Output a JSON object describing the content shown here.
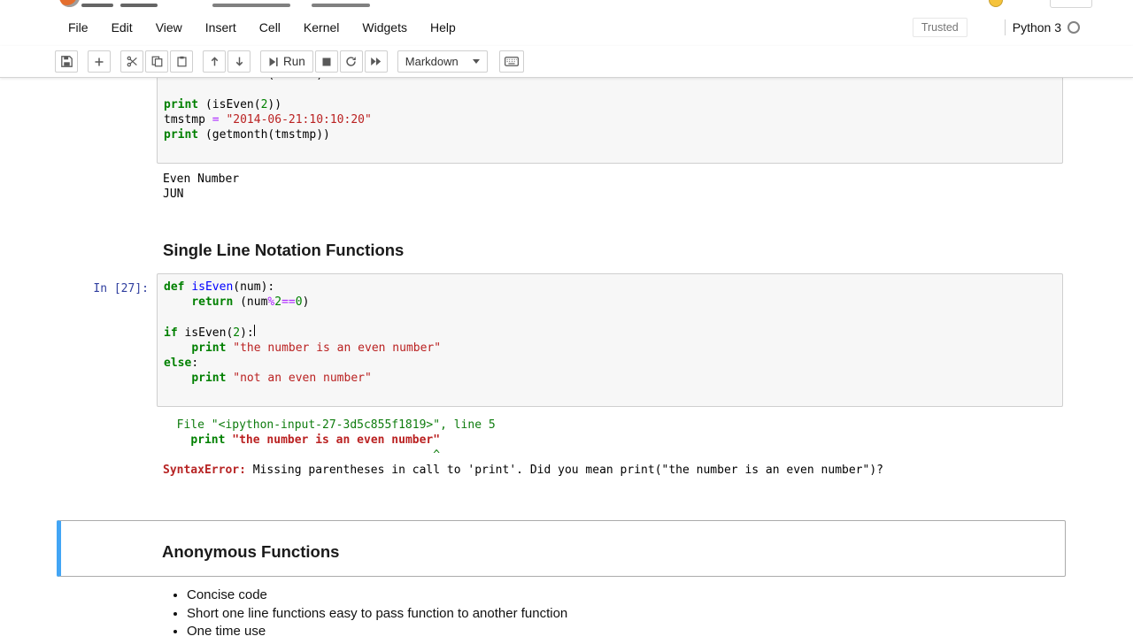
{
  "colors": {
    "selected_cell_accent": "#42A5F5",
    "prompt_blue": "#303F9F",
    "keyword_green": "#008000",
    "string_red": "#BA2121",
    "operator_purple": "#AA22FF",
    "error_red": "#b72424",
    "jupyter_orange": "#e46e2e"
  },
  "header": {
    "icons": [
      "jupyter-logo",
      "user-avatar",
      "logout-button"
    ]
  },
  "menubar": {
    "items": [
      {
        "label": "File"
      },
      {
        "label": "Edit"
      },
      {
        "label": "View"
      },
      {
        "label": "Insert"
      },
      {
        "label": "Cell"
      },
      {
        "label": "Kernel"
      },
      {
        "label": "Widgets"
      },
      {
        "label": "Help"
      }
    ],
    "trusted": "Trusted",
    "kernel": "Python 3"
  },
  "toolbar": {
    "run_label": "Run",
    "cell_type": "Markdown",
    "icons": [
      "save-icon",
      "add-cell-icon",
      "cut-icon",
      "copy-icon",
      "paste-icon",
      "move-up-icon",
      "move-down-icon",
      "run-icon",
      "stop-icon",
      "restart-icon",
      "restart-run-all-icon",
      "command-palette-icon"
    ]
  },
  "cells": {
    "code1": {
      "lines": [
        [],
        [],
        [],
        [
          {
            "t": "        ",
            "c": "pl"
          },
          {
            "t": "return",
            "c": "kw"
          },
          {
            "t": " (months)",
            "c": "pl"
          }
        ],
        [],
        [
          {
            "t": "print",
            "c": "kw"
          },
          {
            "t": " (isEven(",
            "c": "pl"
          },
          {
            "t": "2",
            "c": "nm"
          },
          {
            "t": "))",
            "c": "pl"
          }
        ],
        [
          {
            "t": "tmstmp ",
            "c": "pl"
          },
          {
            "t": "=",
            "c": "op"
          },
          {
            "t": " ",
            "c": "pl"
          },
          {
            "t": "\"2014-06-21:10:10:20\"",
            "c": "st"
          }
        ],
        [
          {
            "t": "print",
            "c": "kw"
          },
          {
            "t": " (getmonth(tmstmp))",
            "c": "pl"
          }
        ],
        []
      ]
    },
    "output1": [
      "Even Number",
      "JUN"
    ],
    "heading1": "Single Line Notation Functions",
    "code2": {
      "prompt": "In [27]:",
      "lines": [
        [
          {
            "t": "def",
            "c": "kw"
          },
          {
            "t": " ",
            "c": "pl"
          },
          {
            "t": "isEven",
            "c": "df"
          },
          {
            "t": "(num):",
            "c": "pl"
          }
        ],
        [
          {
            "t": "    ",
            "c": "pl"
          },
          {
            "t": "return",
            "c": "kw"
          },
          {
            "t": " (num",
            "c": "pl"
          },
          {
            "t": "%",
            "c": "op"
          },
          {
            "t": "2",
            "c": "nm"
          },
          {
            "t": "==",
            "c": "op"
          },
          {
            "t": "0",
            "c": "nm"
          },
          {
            "t": ")",
            "c": "pl"
          }
        ],
        [],
        [
          {
            "t": "if",
            "c": "kw"
          },
          {
            "t": " isEven(",
            "c": "pl"
          },
          {
            "t": "2",
            "c": "nm"
          },
          {
            "t": "):",
            "c": "pl"
          },
          {
            "t": "",
            "c": "cur"
          }
        ],
        [
          {
            "t": "    ",
            "c": "pl"
          },
          {
            "t": "print",
            "c": "kw"
          },
          {
            "t": " ",
            "c": "pl"
          },
          {
            "t": "\"the number is an even number\"",
            "c": "st"
          }
        ],
        [
          {
            "t": "else",
            "c": "kw"
          },
          {
            "t": ":",
            "c": "pl"
          }
        ],
        [
          {
            "t": "    ",
            "c": "pl"
          },
          {
            "t": "print",
            "c": "kw"
          },
          {
            "t": " ",
            "c": "pl"
          },
          {
            "t": "\"not an even number\"",
            "c": "st"
          }
        ],
        []
      ]
    },
    "error": {
      "lines": [
        [
          {
            "t": "  File \"<ipython-input-27-3d5c855f1819>\", line 5",
            "c": "eg"
          }
        ],
        [
          {
            "t": "    ",
            "c": "pl"
          },
          {
            "t": "print",
            "c": "ekw"
          },
          {
            "t": " ",
            "c": "pl"
          },
          {
            "t": "\"the number is an even number\"",
            "c": "est"
          }
        ],
        [
          {
            "t": "                                       ",
            "c": "pl"
          },
          {
            "t": "^",
            "c": "eg"
          }
        ],
        [
          {
            "t": "SyntaxError:",
            "c": "ename"
          },
          {
            "t": " Missing parentheses in call to 'print'. Did you mean print(\"the number is an even number\")?",
            "c": "pl"
          }
        ]
      ]
    },
    "heading2": "Anonymous Functions",
    "bullets": [
      "Concise code",
      "Short one line functions easy to pass function to another function",
      "One time use"
    ]
  }
}
